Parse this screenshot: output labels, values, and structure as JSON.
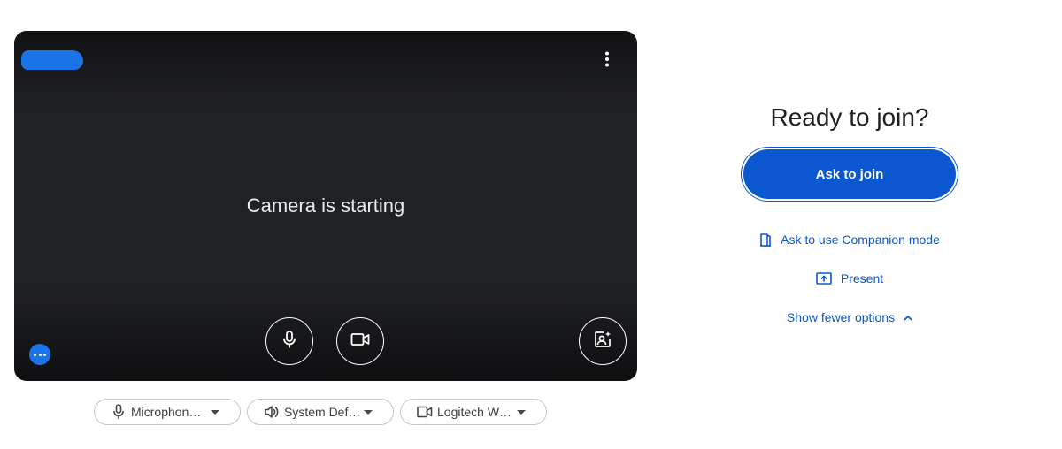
{
  "preview": {
    "status_text": "Camera is starting",
    "name_tag_color": "#1a73e8",
    "more_icon": "more-vert-icon",
    "controls": [
      {
        "name": "microphone-toggle",
        "icon": "mic-icon"
      },
      {
        "name": "camera-toggle",
        "icon": "videocam-icon"
      },
      {
        "name": "visual-effects",
        "icon": "visual-effects-icon"
      }
    ]
  },
  "devices": {
    "microphone": {
      "label": "Microphon…",
      "icon": "mic-icon"
    },
    "speaker": {
      "label": "System Def…",
      "icon": "speaker-icon"
    },
    "camera": {
      "label": "Logitech W…",
      "icon": "videocam-icon"
    }
  },
  "join_panel": {
    "title": "Ready to join?",
    "join_button": "Ask to join",
    "companion_link": "Ask to use Companion mode",
    "present_link": "Present",
    "fewer_link": "Show fewer options"
  },
  "colors": {
    "primary": "#0b57d0",
    "tile_bg": "#202124",
    "accent_badge": "#1a73e8"
  }
}
